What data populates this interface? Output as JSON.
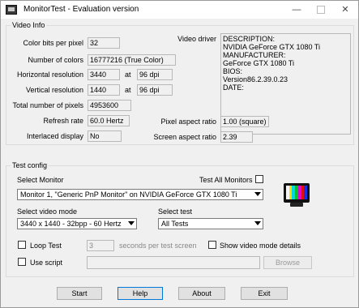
{
  "window": {
    "title": "MonitorTest - Evaluation version",
    "minimize": "—",
    "close": "✕"
  },
  "video_info": {
    "group_title": "Video Info",
    "color_bits": {
      "label": "Color bits per pixel",
      "value": "32"
    },
    "num_colors": {
      "label": "Number of colors",
      "value": "16777216 (True Color)"
    },
    "horiz_res": {
      "label": "Horizontal resolution",
      "value": "3440",
      "at": "at",
      "dpi": "96 dpi"
    },
    "vert_res": {
      "label": "Vertical resolution",
      "value": "1440",
      "at": "at",
      "dpi": "96 dpi"
    },
    "total_pixels": {
      "label": "Total number of pixels",
      "value": "4953600"
    },
    "refresh": {
      "label": "Refresh rate",
      "value": "60.0 Hertz"
    },
    "interlaced": {
      "label": "Interlaced display",
      "value": "No"
    },
    "video_driver": {
      "label": "Video driver",
      "lines": [
        "DESCRIPTION:",
        "NVIDIA GeForce GTX 1080 Ti",
        "MANUFACTURER:",
        "GeForce GTX 1080 Ti",
        "BIOS:",
        "Version86.2.39.0.23",
        "DATE:"
      ]
    },
    "pixel_aspect": {
      "label": "Pixel aspect ratio",
      "value": "1.00 (square)"
    },
    "screen_aspect": {
      "label": "Screen aspect ratio",
      "value": "2.39"
    }
  },
  "test_config": {
    "group_title": "Test config",
    "select_monitor_label": "Select Monitor",
    "test_all_label": "Test All Monitors",
    "monitor_value": "Monitor 1, \"Generic PnP Monitor\" on NVIDIA GeForce GTX 1080 Ti",
    "video_mode_label": "Select video mode",
    "video_mode_value": "3440 x 1440 - 32bpp - 60 Hertz",
    "select_test_label": "Select test",
    "select_test_value": "All Tests",
    "loop_test_label": "Loop Test",
    "loop_seconds": "3",
    "seconds_label": "seconds per test screen",
    "show_details_label": "Show video mode details",
    "use_script_label": "Use script",
    "script_path": "",
    "browse_label": "Browse",
    "monitor_icon": "monitor-test-pattern-icon"
  },
  "buttons": {
    "start": "Start",
    "help": "Help",
    "about": "About",
    "exit": "Exit"
  }
}
